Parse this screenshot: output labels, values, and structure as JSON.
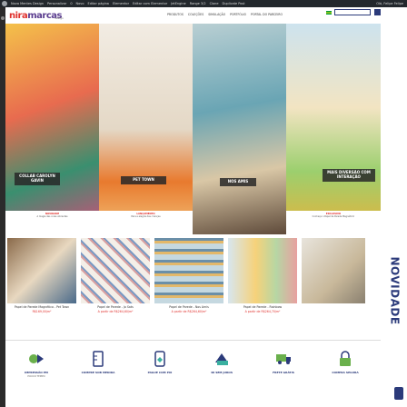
{
  "admin_bar": {
    "items": [
      "Nova Mentes Design",
      "Personalizar",
      "0",
      "Novo",
      "Editar página",
      "Elementor",
      "Editar com Elementor",
      "JetEngine",
      "Range 3/2",
      "Clone",
      "Duplicate Post"
    ],
    "user": "Olá, Felipe Felipe"
  },
  "header": {
    "logo_part1": "nira",
    "logo_part2": "marcas",
    "logo_sub": "design",
    "nav": [
      "PRODUTOS",
      "COLEÇÕES",
      "SIMULAÇÃO",
      "PORTFÓLIO",
      "PORTAL DO PARCEIRO"
    ]
  },
  "tiles": [
    {
      "title": "COLLAB CAROLYN GAVIN",
      "label": "NOVIDADE",
      "desc": "A magia das cores vibrantes",
      "color": "#c94a3a"
    },
    {
      "title": "PET TOWN",
      "label": "LANÇAMENTO",
      "desc": "Para a alegria das crianças",
      "color": "#d98a3a"
    },
    {
      "title": "NOS AMIS",
      "label": "",
      "desc": "",
      "color": "#3f7a8f"
    },
    {
      "title": "MAIS DIVERSÃO COM INTERAÇÃO",
      "label": "EXCLUSIVO",
      "desc": "Conheça o Papel de Parede Magnético!",
      "color": "#7fb5cc"
    }
  ],
  "section_label": "NOVIDADE",
  "products": [
    {
      "name": "Papel de Parede Magnético - Pet Town",
      "price": "R$169,00/m²",
      "unit": "por m²"
    },
    {
      "name": "Papel de Parede - Jo Sats",
      "price": "A partir de R$264,60/m²",
      "unit": ""
    },
    {
      "name": "Papel de Parede - Nos Amis",
      "price": "A partir de R$264,60/m²",
      "unit": ""
    },
    {
      "name": "Papel de Parede - Rainbow",
      "price": "A partir de R$264,70/m²",
      "unit": ""
    },
    {
      "name": "Papel de Parede - Casa",
      "price": "A partir de R$264,60/m²",
      "unit": ""
    }
  ],
  "features": [
    {
      "label": "IMPRESSÃO EM",
      "sub": "POUCO TEMPO",
      "icon": "print-icon"
    },
    {
      "label": "COMPRE SOB MEDIDA",
      "sub": "",
      "icon": "ruler-icon"
    },
    {
      "label": "PAGUE COM PIX",
      "sub": "",
      "icon": "pix-icon"
    },
    {
      "label": "48 SEM JUROS",
      "sub": "",
      "icon": "card-icon"
    },
    {
      "label": "FRETE GRÁTIS",
      "sub": "",
      "icon": "truck-icon"
    },
    {
      "label": "COMPRA SEGURA",
      "sub": "",
      "icon": "lock-icon"
    }
  ],
  "colors": {
    "brand_red": "#e0312d",
    "brand_purple": "#5b3d8f",
    "brand_blue": "#2b3a7a"
  }
}
